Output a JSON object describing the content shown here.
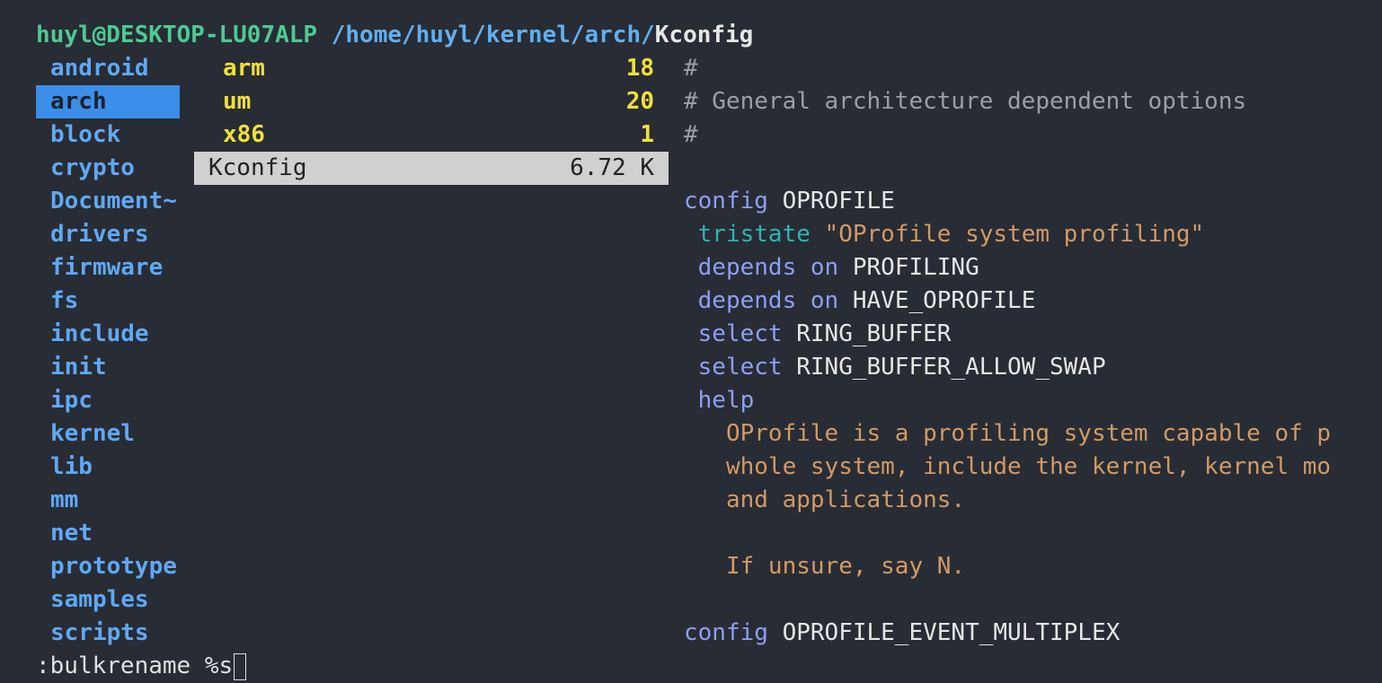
{
  "title": {
    "user_host": "huyl@DESKTOP-LU07ALP",
    "path": "/home/huyl/kernel/arch/",
    "file": "Kconfig"
  },
  "left_column": [
    "android",
    "arch",
    "block",
    "crypto",
    "Document~",
    "drivers",
    "firmware",
    "fs",
    "include",
    "init",
    "ipc",
    "kernel",
    "lib",
    "mm",
    "net",
    "prototype",
    "samples",
    "scripts"
  ],
  "left_selected_index": 1,
  "middle_column": [
    {
      "name": "arm",
      "info": "18",
      "kind": "dir"
    },
    {
      "name": "um",
      "info": "20",
      "kind": "dir"
    },
    {
      "name": "x86",
      "info": "1",
      "kind": "dir"
    },
    {
      "name": "Kconfig",
      "info": "6.72 K",
      "kind": "file"
    }
  ],
  "middle_selected_index": 3,
  "preview": {
    "l1": "#",
    "l2": "# General architecture dependent options",
    "l3": "#",
    "l5_kw": "config",
    "l5_val": " OPROFILE",
    "l6_kw": "tristate",
    "l6_str": "\"OProfile system profiling\"",
    "l7_kw": "depends on",
    "l7_val": " PROFILING",
    "l8_kw": "depends on",
    "l8_val": " HAVE_OPROFILE",
    "l9_kw": "select",
    "l9_val": " RING_BUFFER",
    "l10_kw": "select",
    "l10_val": " RING_BUFFER_ALLOW_SWAP",
    "l11_kw": "help",
    "l12": "OProfile is a profiling system capable of p",
    "l13": "whole system, include the kernel, kernel mo",
    "l14": "and applications.",
    "l16": "If unsure, say N.",
    "l18_kw": "config",
    "l18_val": " OPROFILE_EVENT_MULTIPLEX"
  },
  "command_line": ":bulkrename %s",
  "colors": {
    "background": "#282c34",
    "selection_left": "#3b8eea",
    "selection_middle": "#d0d0d0",
    "directory": "#5fa8f5",
    "yellow_dir": "#f0e03c"
  }
}
